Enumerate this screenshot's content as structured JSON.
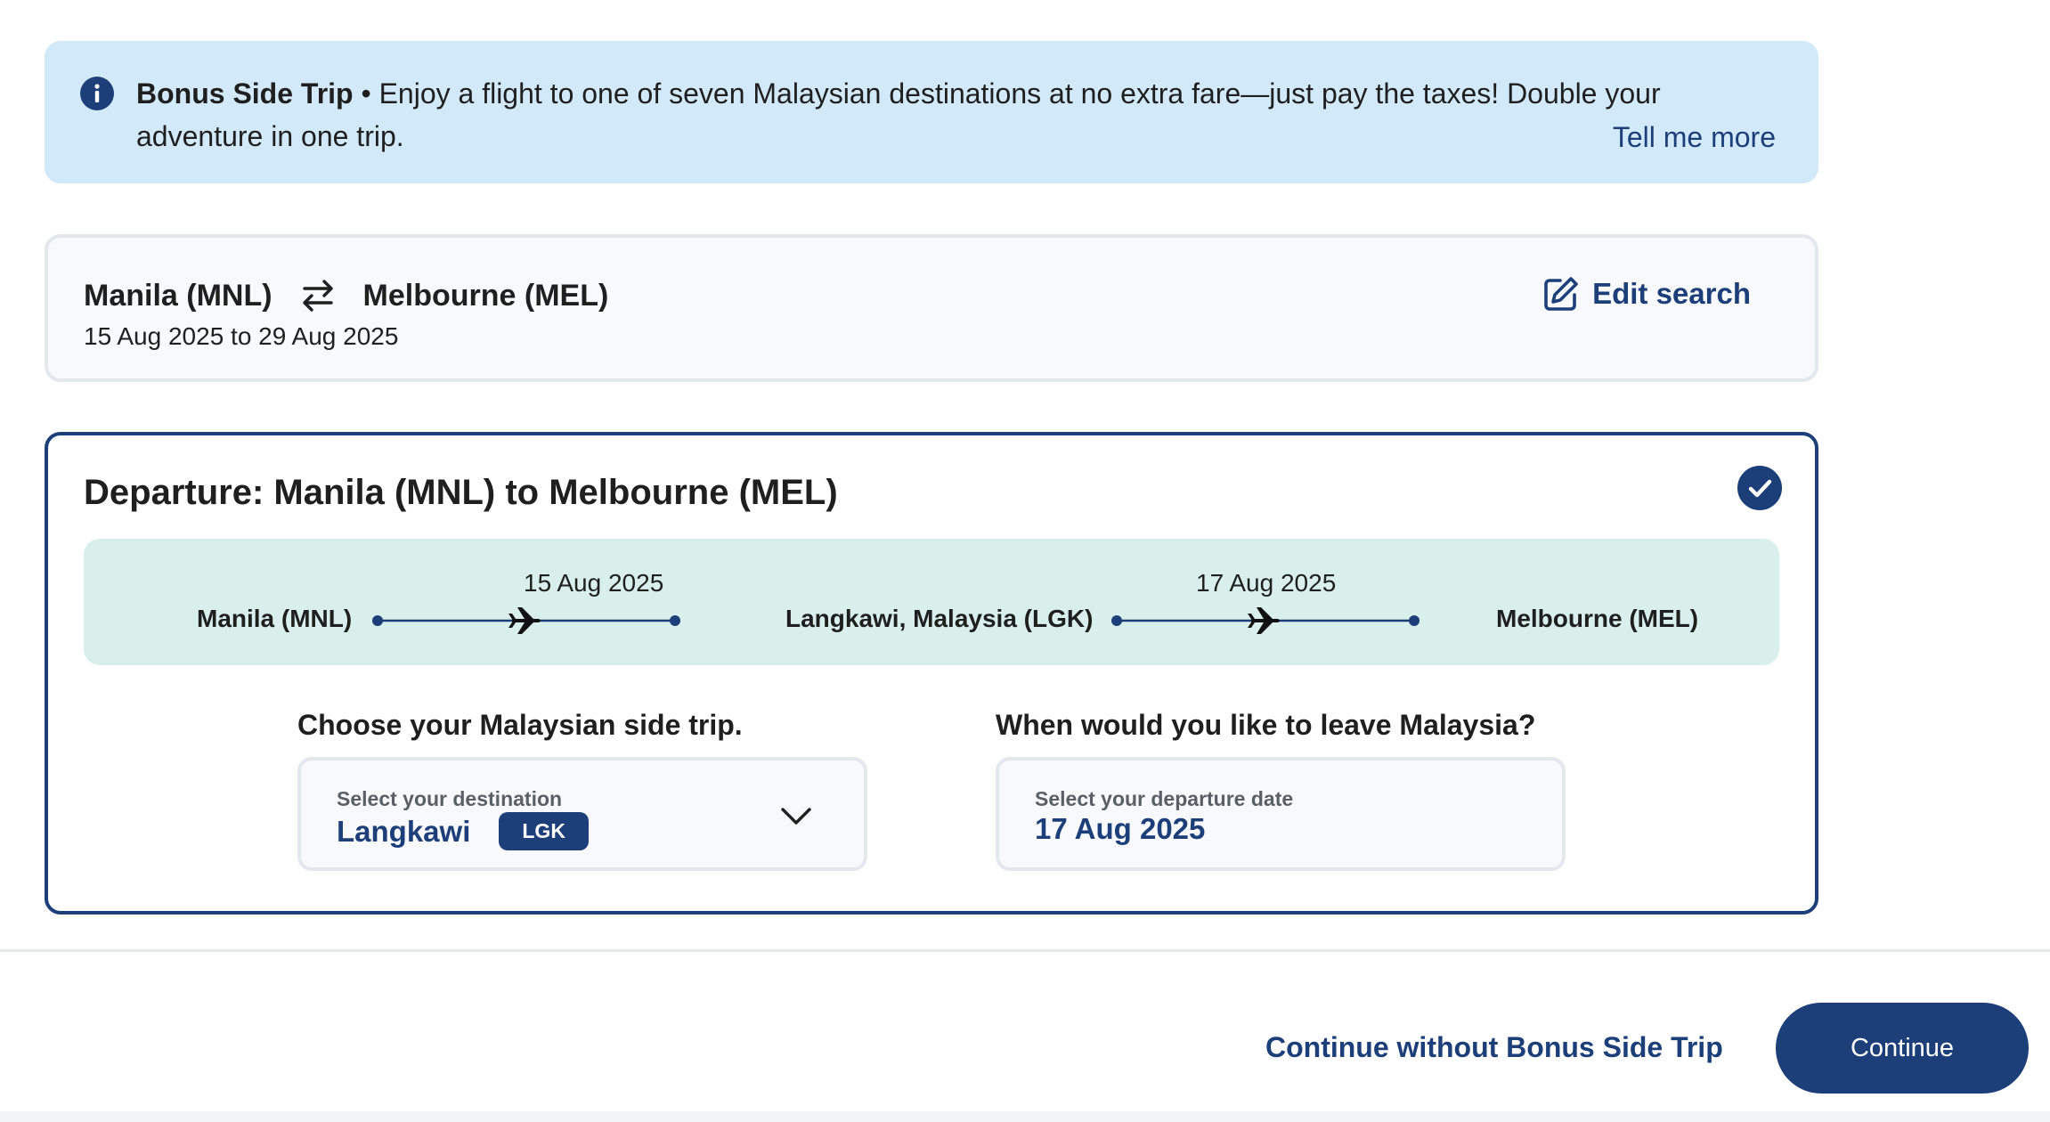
{
  "banner": {
    "icon": "info-icon",
    "title": "Bonus Side Trip",
    "separator": " • ",
    "message": "Enjoy a flight to one of seven Malaysian destinations at no extra fare—just pay the taxes! Double your adventure in one trip.",
    "link": "Tell me more"
  },
  "search": {
    "origin": "Manila (MNL)",
    "destination": "Melbourne (MEL)",
    "swap_icon": "swap-arrows-icon",
    "dates": "15 Aug 2025 to 29 Aug 2025",
    "edit_label": "Edit search",
    "edit_icon": "edit-icon"
  },
  "departure": {
    "title": "Departure: Manila (MNL) to Melbourne (MEL)",
    "selected_icon": "check-circle-icon",
    "itinerary": {
      "origin": "Manila (MNL)",
      "leg1_date": "15 Aug 2025",
      "stop": "Langkawi, Malaysia (LGK)",
      "leg2_date": "17 Aug 2025",
      "destination": "Melbourne (MEL)"
    },
    "side_trip": {
      "question": "Choose your Malaysian side trip.",
      "label": "Select your destination",
      "value": "Langkawi",
      "code": "LGK"
    },
    "leave": {
      "question": "When would you like to leave Malaysia?",
      "label": "Select your departure date",
      "value": "17 Aug 2025"
    }
  },
  "footer": {
    "skip_label": "Continue without Bonus Side Trip",
    "continue_label": "Continue"
  },
  "colors": {
    "primary": "#1c3f7a",
    "banner_bg": "#d2e9f9",
    "itinerary_bg": "#d8efec"
  }
}
